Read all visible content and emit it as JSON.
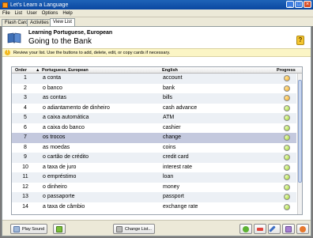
{
  "window": {
    "title": "Let's Learn a Language"
  },
  "menu": [
    "File",
    "List",
    "User",
    "Options",
    "Help"
  ],
  "tabs": [
    {
      "label": "Flash Cards"
    },
    {
      "label": "Activities"
    },
    {
      "label": "View List"
    }
  ],
  "header": {
    "lesson_title": "Learning Portuguese, European",
    "lesson_subtitle": "Going to the Bank",
    "help_symbol": "?"
  },
  "info": {
    "text": "Review your list. Use the buttons to add, delete, edit, or copy cards if necessary."
  },
  "table": {
    "columns": {
      "order": "Order",
      "portuguese": "Portuguese, European",
      "english": "English",
      "progress": "Progress"
    },
    "rows": [
      {
        "order": "1",
        "pt": "a conta",
        "en": "account",
        "progress": "orange"
      },
      {
        "order": "2",
        "pt": "o banco",
        "en": "bank",
        "progress": "orange"
      },
      {
        "order": "3",
        "pt": "as contas",
        "en": "bills",
        "progress": "orange"
      },
      {
        "order": "4",
        "pt": "o adiantamento de dinheiro",
        "en": "cash advance",
        "progress": "green"
      },
      {
        "order": "5",
        "pt": "a caixa automática",
        "en": "ATM",
        "progress": "green"
      },
      {
        "order": "6",
        "pt": "a caixa do banco",
        "en": "cashier",
        "progress": "green"
      },
      {
        "order": "7",
        "pt": "os trocos",
        "en": "change",
        "progress": "green"
      },
      {
        "order": "8",
        "pt": "as moedas",
        "en": "coins",
        "progress": "green"
      },
      {
        "order": "9",
        "pt": "o cartão de crédito",
        "en": "credit card",
        "progress": "green"
      },
      {
        "order": "10",
        "pt": "a taxa de juro",
        "en": "interest rate",
        "progress": "green"
      },
      {
        "order": "11",
        "pt": "o empréstimo",
        "en": "loan",
        "progress": "green"
      },
      {
        "order": "12",
        "pt": "o dinheiro",
        "en": "money",
        "progress": "green"
      },
      {
        "order": "13",
        "pt": "o passaporte",
        "en": "passport",
        "progress": "green"
      },
      {
        "order": "14",
        "pt": "a taxa de câmbio",
        "en": "exchange rate",
        "progress": "green"
      }
    ],
    "selected_row_index": 6
  },
  "toolbar": {
    "play_sound": "Play Sound",
    "change_list": "Change List..."
  },
  "colors": {
    "titlebar": "#0b47a0",
    "selected_row": "#c4c9de",
    "info_bar": "#fbf5c5",
    "progress_orange": "#f0a51e",
    "progress_green": "#9cd22a"
  }
}
